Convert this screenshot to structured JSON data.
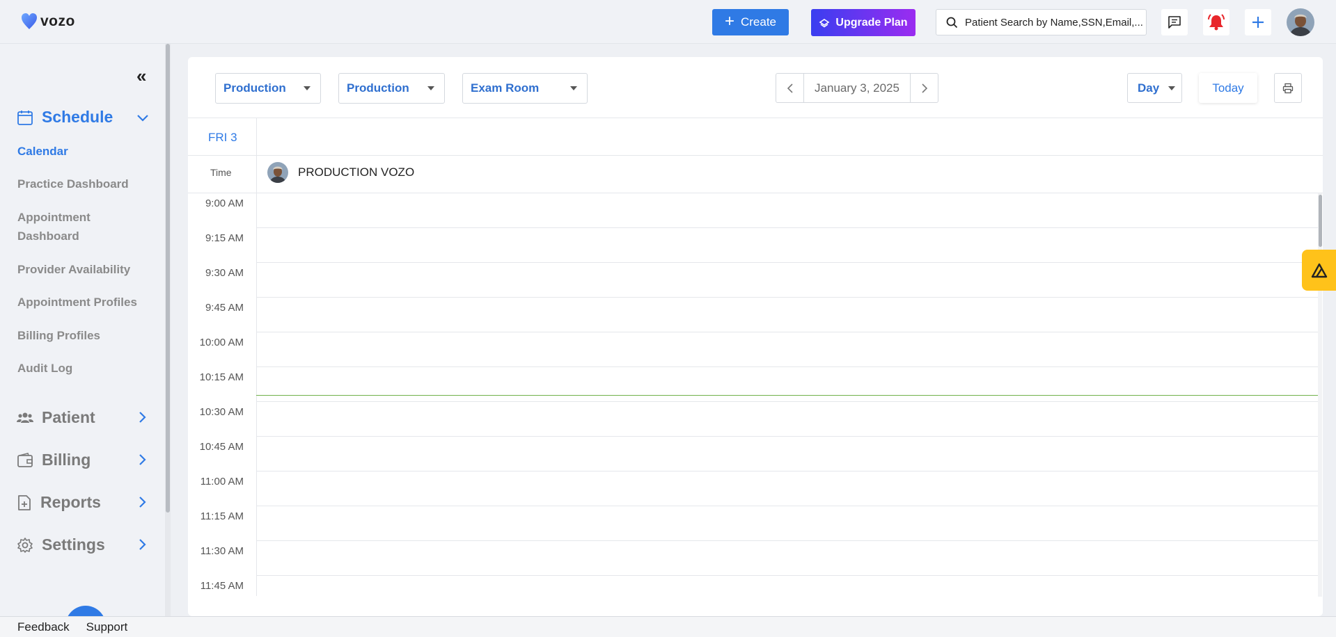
{
  "app": {
    "logo_text": "vozo"
  },
  "topbar": {
    "create_label": "Create",
    "upgrade_label": "Upgrade Plan",
    "search_placeholder": "Patient Search by Name,SSN,Email,...",
    "colors": {
      "primary": "#2f7ae5",
      "upgrade_start": "#3a3ef0",
      "upgrade_end": "#9b2cf0",
      "bell": "#e8262b"
    }
  },
  "sidebar": {
    "schedule": {
      "label": "Schedule",
      "items": [
        {
          "label": "Calendar",
          "active": true
        },
        {
          "label": "Practice Dashboard"
        },
        {
          "label": "Appointment Dashboard"
        },
        {
          "label": "Provider Availability"
        },
        {
          "label": "Appointment Profiles"
        },
        {
          "label": "Billing Profiles"
        },
        {
          "label": "Audit Log"
        }
      ]
    },
    "sections": [
      {
        "label": "Patient",
        "icon": "users-icon"
      },
      {
        "label": "Billing",
        "icon": "wallet-icon"
      },
      {
        "label": "Reports",
        "icon": "report-icon"
      },
      {
        "label": "Settings",
        "icon": "gear-icon"
      }
    ]
  },
  "footer": {
    "feedback": "Feedback",
    "support": "Support"
  },
  "toolbar": {
    "filter1": "Production",
    "filter2": "Production",
    "filter3": "Exam Room",
    "date": "January 3, 2025",
    "view": "Day",
    "today": "Today"
  },
  "calendar": {
    "day_label": "FRI 3",
    "time_header": "Time",
    "provider": "PRODUCTION VOZO",
    "times": [
      "9:00 AM",
      "9:15 AM",
      "9:30 AM",
      "9:45 AM",
      "10:00 AM",
      "10:15 AM",
      "10:30 AM",
      "10:45 AM",
      "11:00 AM",
      "11:15 AM",
      "11:30 AM",
      "11:45 AM"
    ],
    "now_line_color": "#6fb24a"
  }
}
